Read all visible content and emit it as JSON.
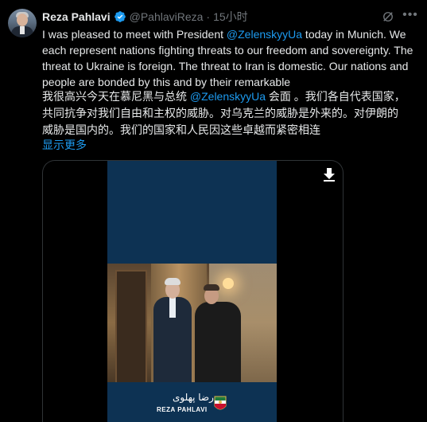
{
  "author": {
    "display_name": "Reza Pahlavi",
    "handle": "@PahlaviReza",
    "separator": "·",
    "time": "15小时"
  },
  "tweet": {
    "part1": "I was pleased to meet with President ",
    "mention": "@ZelenskyyUa",
    "part2": " today in Munich. We each represent nations fighting threats to our freedom and sovereignty. The threat to Ukraine is foreign. The threat to Iran is domestic. Our nations and people are bonded by this and by their remarkable"
  },
  "translation": {
    "part1": "我很高兴今天在慕尼黑与总统 ",
    "mention": "@ZelenskyyUa",
    "part2": " 会面 。我们各自代表国家，共同抗争对我们自由和主权的威胁。对乌克兰的威胁是外来的。对伊朗的威胁是国内的。我们的国家和人民因这些卓越而紧密相连"
  },
  "show_more": "显示更多",
  "media": {
    "logo_farsi": "رضا پهلوی",
    "logo_name": "REZA PAHLAVI"
  },
  "icons": {
    "verified": "verified-badge-icon",
    "grok": "grok-icon",
    "more": "more-icon",
    "download": "download-icon"
  },
  "colors": {
    "background": "#000000",
    "text": "#e7e9ea",
    "secondary": "#71767b",
    "link": "#1d9bf0",
    "video_bg": "#0d3253"
  }
}
